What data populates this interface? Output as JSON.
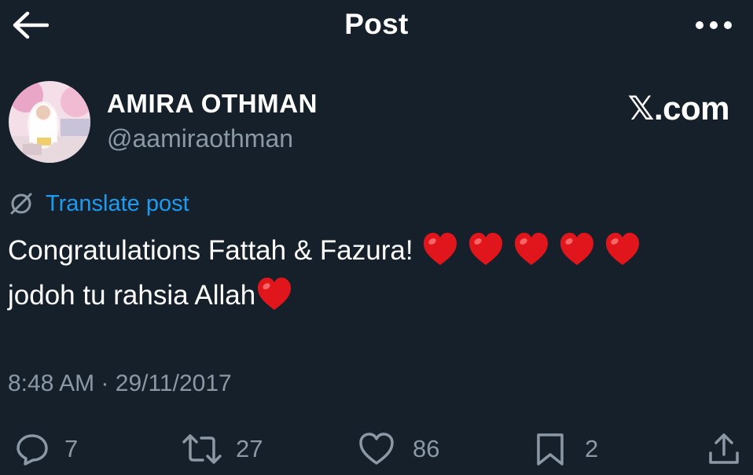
{
  "header": {
    "title": "Post",
    "back_icon": "arrow-left-icon",
    "more_icon": "more-horizontal-icon"
  },
  "author": {
    "display_name": "AMIRA OTHMAN",
    "handle": "@aamiraothman"
  },
  "watermark": "𝕏.com",
  "translate": {
    "label": "Translate post",
    "icon": "translate-globe-icon"
  },
  "post": {
    "line1": "Congratulations Fattah & Fazura!",
    "line1_hearts": 5,
    "line2": "jodoh tu rahsia Allah",
    "line2_hearts": 1
  },
  "meta": {
    "time": "8:48 AM",
    "separator": "·",
    "date": "29/11/2017"
  },
  "actions": {
    "replies": "7",
    "reposts": "27",
    "likes": "86",
    "bookmarks": "2"
  },
  "colors": {
    "background": "#15202b",
    "accent": "#1d9bf0",
    "muted": "#8b98a5",
    "heart": "#e0161c"
  }
}
